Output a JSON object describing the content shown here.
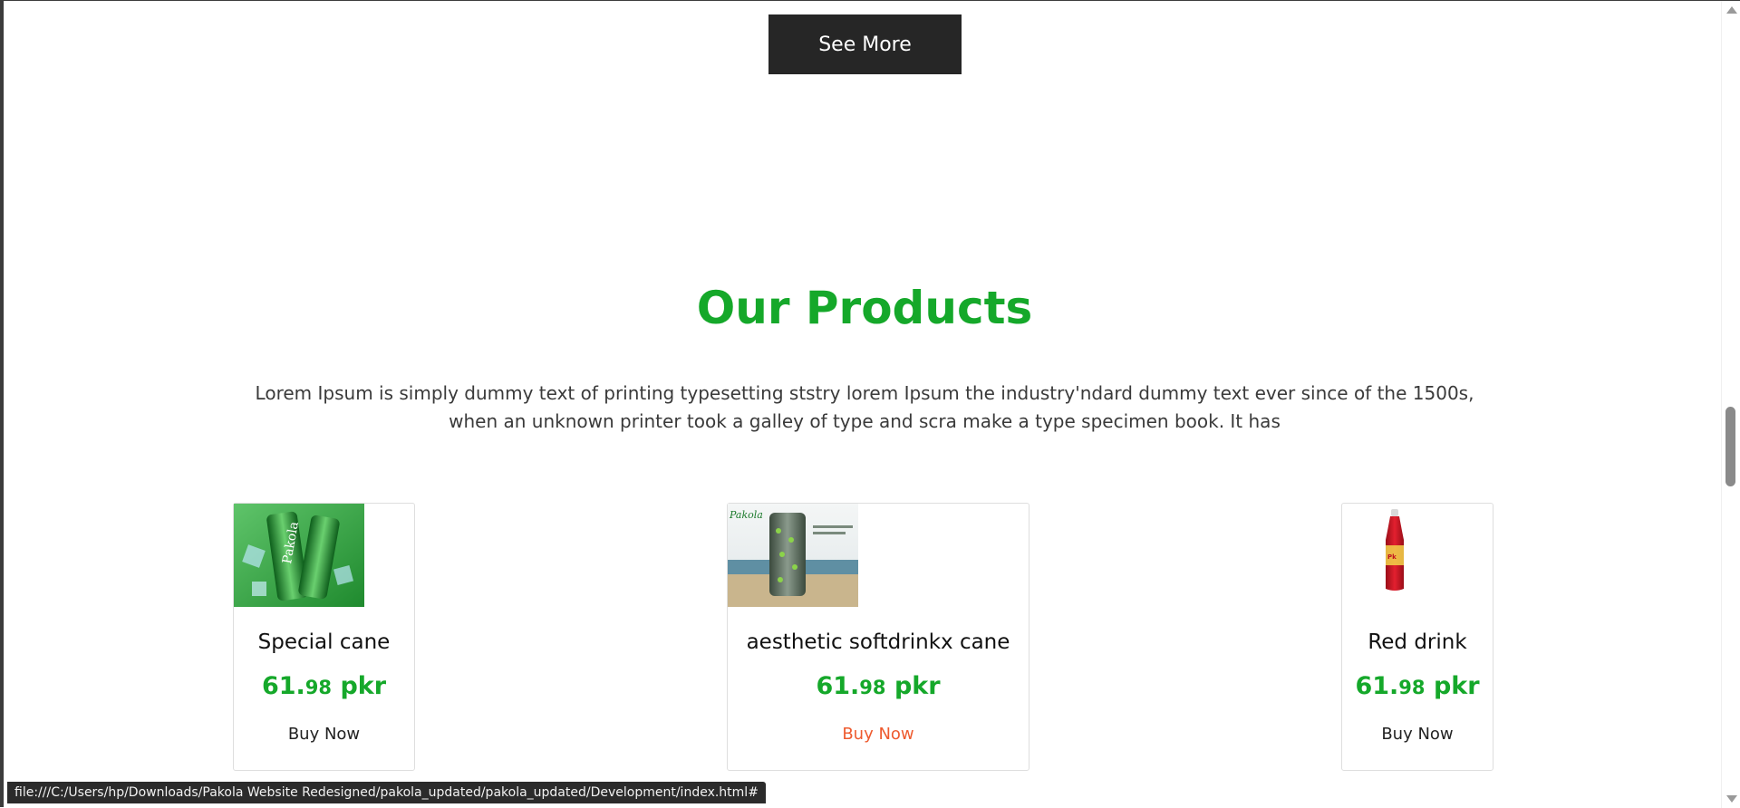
{
  "see_more_label": "See More",
  "section": {
    "title": "Our Products",
    "description": "Lorem Ipsum is simply dummy text of printing typesetting ststry lorem Ipsum the industry'ndard dummy text ever since of the 1500s, when an unknown printer took a galley of type and scra make a type specimen book. It has"
  },
  "products": [
    {
      "name": "Special cane",
      "price_main": "61.",
      "price_cents": "98",
      "currency": "pkr",
      "buy_label": "Buy Now",
      "image": "green-cans-image"
    },
    {
      "name": "aesthetic softdrinkx cane",
      "price_main": "61.",
      "price_cents": "98",
      "currency": "pkr",
      "buy_label": "Buy Now",
      "image": "beach-can-image"
    },
    {
      "name": "Red drink",
      "price_main": "61.",
      "price_cents": "98",
      "currency": "pkr",
      "buy_label": "Buy Now",
      "image": "red-bottle-image"
    }
  ],
  "status_url": "file:///C:/Users/hp/Downloads/Pakola Website Redesigned/pakola_updated/pakola_updated/Development/index.html#",
  "colors": {
    "accent_green": "#15a82a",
    "button_dark": "#262626",
    "hover_orange": "#ee5a2e"
  }
}
